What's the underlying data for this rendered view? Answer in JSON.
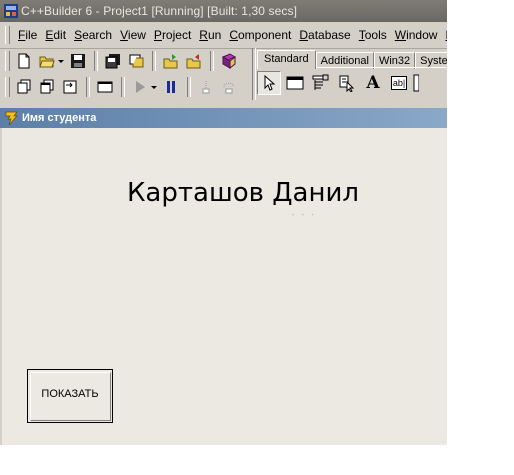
{
  "ide": {
    "title": "C++Builder 6 - Project1 [Running] [Built: 1,30 secs]"
  },
  "menu": {
    "items": [
      {
        "accel": "F",
        "rest": "ile"
      },
      {
        "accel": "E",
        "rest": "dit"
      },
      {
        "accel": "S",
        "rest": "earch"
      },
      {
        "accel": "V",
        "rest": "iew"
      },
      {
        "accel": "P",
        "rest": "roject"
      },
      {
        "accel": "R",
        "rest": "un"
      },
      {
        "accel": "C",
        "rest": "omponent"
      },
      {
        "accel": "D",
        "rest": "atabase"
      },
      {
        "accel": "T",
        "rest": "ools"
      },
      {
        "accel": "W",
        "rest": "indow"
      },
      {
        "accel": "H",
        "rest": "e"
      }
    ]
  },
  "palette": {
    "tabs": [
      "Standard",
      "Additional",
      "Win32",
      "System"
    ],
    "active_tab": "Standard",
    "label_glyph": "A",
    "edit_glyph": "ab|"
  },
  "form": {
    "caption": "Имя студента",
    "name_label": "Карташов Данил",
    "show_button": "ПОКАЗАТЬ"
  },
  "colors": {
    "form_caption_start": "#5c7fa8",
    "form_caption_end": "#8aa8c8",
    "form_background": "#ece9e2",
    "ide_background": "#d4d0c8"
  }
}
